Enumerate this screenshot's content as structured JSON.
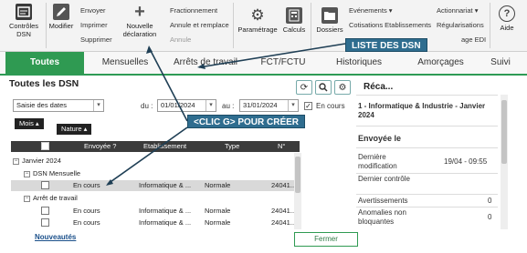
{
  "ribbon": {
    "controles": "Contrôles",
    "dsn": "DSN",
    "modifier": "Modifier",
    "envoyer": "Envoyer",
    "imprimer": "Imprimer",
    "supprimer": "Supprimer",
    "nouvelle": "Nouvelle",
    "declaration": "déclaration",
    "fractionnement": "Fractionnement",
    "annule_remplace": "Annule et remplace",
    "annule": "Annule",
    "parametrage": "Paramétrage",
    "calculs": "Calculs",
    "dossiers": "Dossiers",
    "evenements": "Evénements",
    "cotisations": "Cotisations Etablissements",
    "actionnariat": "Actionnariat",
    "regularisations": "Régularisations",
    "usage_edi": "age EDI",
    "aide": "Aide"
  },
  "tabs": [
    "Toutes",
    "Mensuelles",
    "Arrêts de travail",
    "FCT/FCTU",
    "Historiques",
    "Amorçages",
    "Suivi"
  ],
  "left": {
    "title": "Toutes les DSN",
    "date_mode": "Saisie des dates",
    "du_label": "du :",
    "date_from": "01/01/2024",
    "au_label": "au :",
    "date_to": "31/01/2024",
    "en_cours_label": "En cours",
    "group_mois": "Mois",
    "group_nature": "Nature",
    "columns": [
      "Envoyée ?",
      "Etablissement",
      "Type",
      "N°"
    ],
    "groups": {
      "month": "Janvier 2024",
      "dsn_mensuelle": "DSN Mensuelle",
      "arret": "Arrêt de travail"
    },
    "rows": [
      {
        "envoyee": "En cours",
        "etab": "Informatique & ...",
        "type": "Normale",
        "num": "24041..."
      },
      {
        "envoyee": "En cours",
        "etab": "Informatique & ...",
        "type": "Normale",
        "num": "24041..."
      },
      {
        "envoyee": "En cours",
        "etab": "Informatique & ...",
        "type": "Normale",
        "num": "24041..."
      }
    ],
    "nouveautes": "Nouveautés"
  },
  "right": {
    "title": "Réca...",
    "entity": "1 - Informatique & Industrie - Janvier 2024",
    "envoyee_le": "Envoyée le",
    "derniere_modification": "Dernière modification",
    "derniere_modification_val": "19/04 - 09:55",
    "dernier_controle": "Dernier contrôle",
    "avertissements": "Avertissements",
    "avertissements_val": "0",
    "anomalies": "Anomalies non bloquantes",
    "anomalies_val": "0",
    "fermer": "Fermer"
  },
  "callouts": {
    "liste": "LISTE DES DSN",
    "clic": "<CLIC G> POUR CRÉER"
  },
  "colors": {
    "accent": "#2f9a52",
    "callout": "#2f6d8f"
  }
}
